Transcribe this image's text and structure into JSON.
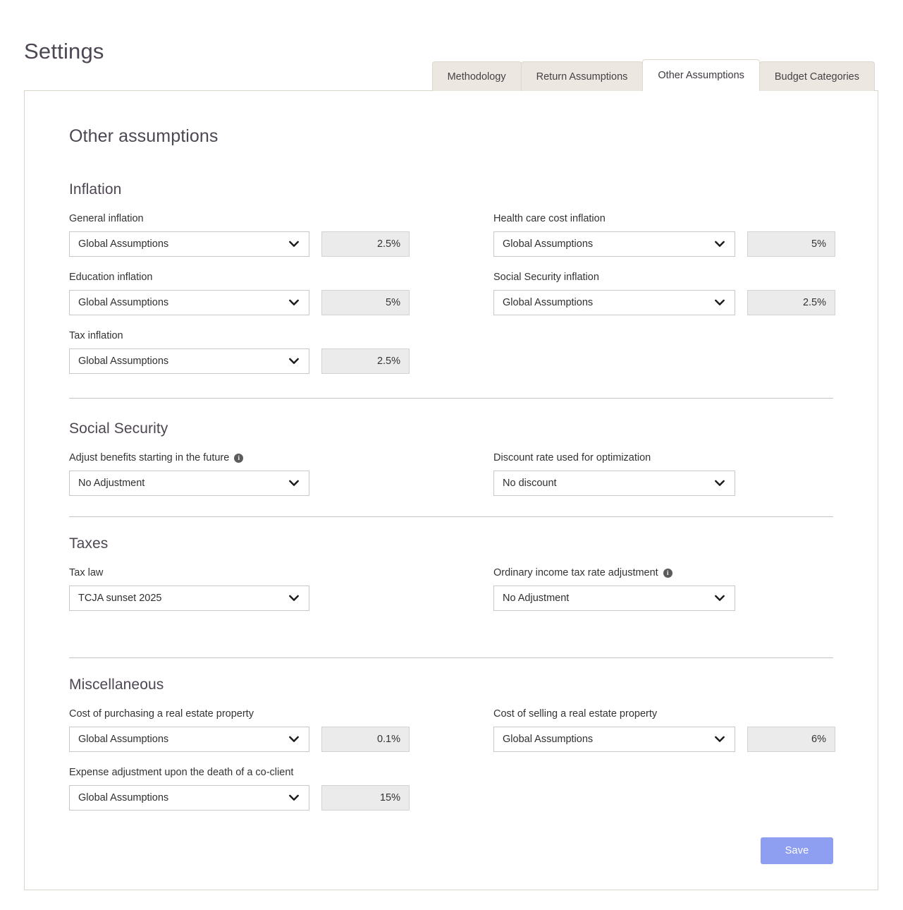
{
  "page": {
    "title": "Settings"
  },
  "tabs": [
    {
      "label": "Methodology",
      "active": false
    },
    {
      "label": "Return Assumptions",
      "active": false
    },
    {
      "label": "Other Assumptions",
      "active": true
    },
    {
      "label": "Budget Categories",
      "active": false
    }
  ],
  "card": {
    "heading": "Other assumptions",
    "sections": [
      {
        "id": "inflation",
        "heading": "Inflation",
        "fields": [
          {
            "label": "General inflation",
            "info": false,
            "select": "Global Assumptions",
            "value": "2.5%"
          },
          {
            "label": "Health care cost inflation",
            "info": false,
            "select": "Global Assumptions",
            "value": "5%"
          },
          {
            "label": "Education inflation",
            "info": false,
            "select": "Global Assumptions",
            "value": "5%"
          },
          {
            "label": "Social Security inflation",
            "info": false,
            "select": "Global Assumptions",
            "value": "2.5%"
          },
          {
            "label": "Tax inflation",
            "info": false,
            "select": "Global Assumptions",
            "value": "2.5%"
          }
        ]
      },
      {
        "id": "social-security",
        "heading": "Social Security",
        "fields": [
          {
            "label": "Adjust benefits starting in the future",
            "info": true,
            "select": "No Adjustment",
            "value": null
          },
          {
            "label": "Discount rate used for optimization",
            "info": false,
            "select": "No discount",
            "value": null
          }
        ]
      },
      {
        "id": "taxes",
        "heading": "Taxes",
        "fields": [
          {
            "label": "Tax law",
            "info": false,
            "select": "TCJA sunset 2025",
            "value": null
          },
          {
            "label": "Ordinary income tax rate adjustment",
            "info": true,
            "select": "No Adjustment",
            "value": null
          }
        ]
      },
      {
        "id": "miscellaneous",
        "heading": "Miscellaneous",
        "fields": [
          {
            "label": "Cost of purchasing a real estate property",
            "info": false,
            "select": "Global Assumptions",
            "value": "0.1%"
          },
          {
            "label": "Cost of selling a real estate property",
            "info": false,
            "select": "Global Assumptions",
            "value": "6%"
          },
          {
            "label": "Expense adjustment upon the death of a co-client",
            "info": false,
            "select": "Global Assumptions",
            "value": "15%"
          }
        ]
      }
    ],
    "save_label": "Save"
  },
  "icons": {
    "info": "i",
    "chevron": "chevron-down-icon"
  },
  "colors": {
    "accent": "#8e9ef0",
    "tab_inactive_bg": "#ece8e1",
    "card_border": "#dad5cb",
    "value_box_bg": "#ebebeb",
    "heading_text": "#4e4652"
  }
}
